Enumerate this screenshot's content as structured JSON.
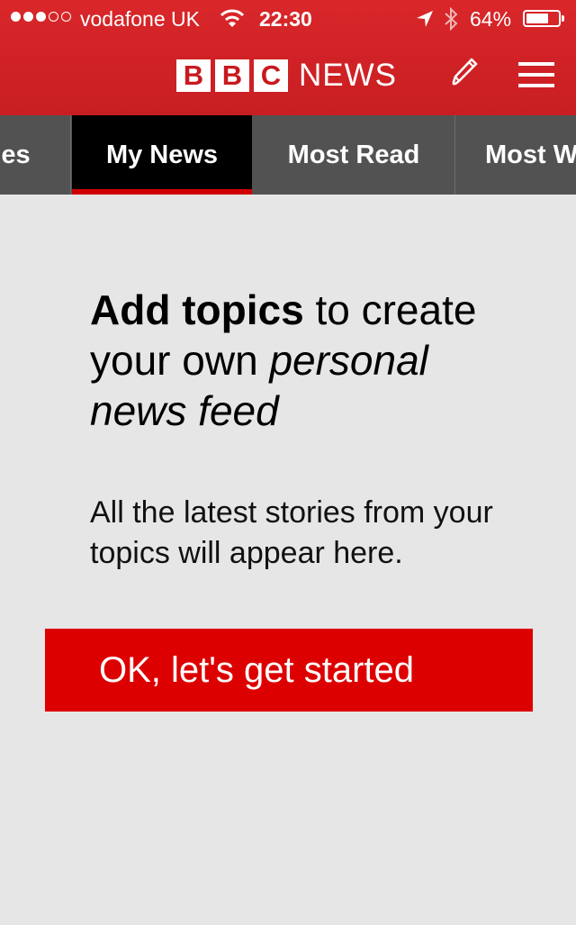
{
  "status_bar": {
    "signal_dots_filled": 3,
    "signal_dots_total": 5,
    "carrier": "vodafone UK",
    "time": "22:30",
    "battery_percent": "64%",
    "battery_level": 0.64,
    "icons": [
      "wifi-icon",
      "location-arrow-icon",
      "bluetooth-icon",
      "battery-icon"
    ]
  },
  "header": {
    "logo_letters": [
      "B",
      "B",
      "C"
    ],
    "logo_word": "NEWS",
    "edit_icon": "pencil-icon",
    "menu_icon": "hamburger-menu-icon",
    "background_color": "#c81e22"
  },
  "tabs": [
    {
      "label": "ries",
      "active": false
    },
    {
      "label": "My News",
      "active": true
    },
    {
      "label": "Most Read",
      "active": false
    },
    {
      "label": "Most W",
      "active": false
    }
  ],
  "main": {
    "headline_bold": "Add topics",
    "headline_rest": " to create your own ",
    "headline_italic": "personal news feed",
    "subtext": "All the latest stories from your topics will appear here.",
    "cta_label": "OK, let's get started",
    "cta_color": "#dd0000"
  }
}
